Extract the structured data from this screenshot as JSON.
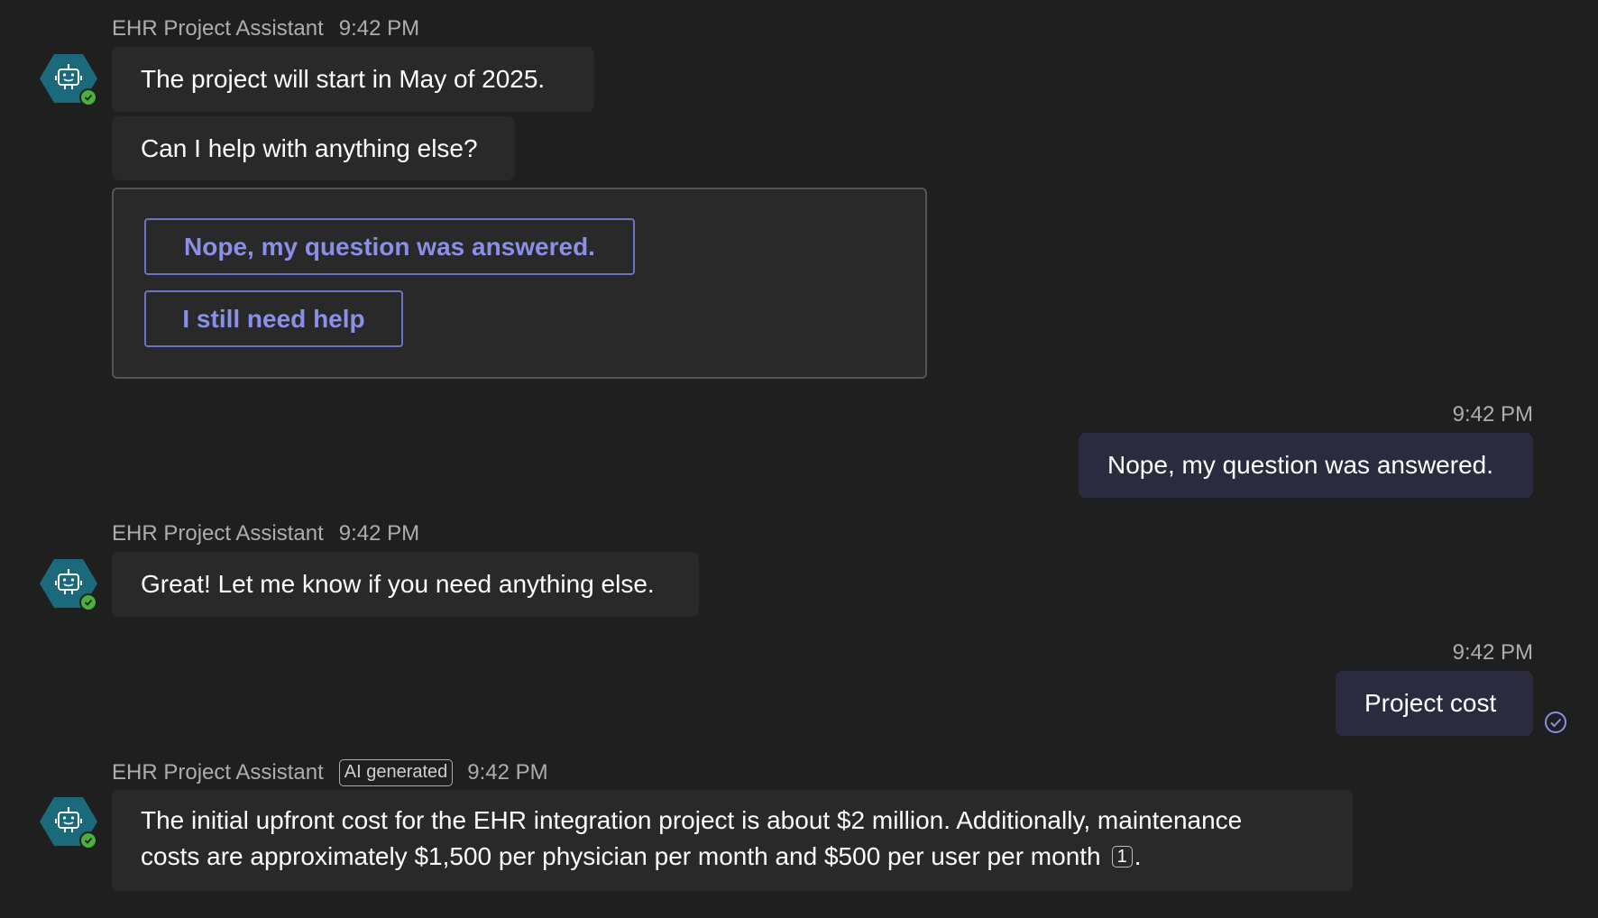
{
  "messages": [
    {
      "sender": "EHR Project Assistant",
      "time": "9:42 PM",
      "texts": [
        "The project will start in May of 2025.",
        "Can I help with anything else?"
      ],
      "actions": [
        "Nope, my question was answered.",
        "I still need help"
      ]
    },
    {
      "time": "9:42 PM",
      "text": "Nope, my question was answered."
    },
    {
      "sender": "EHR Project Assistant",
      "time": "9:42 PM",
      "text": "Great! Let me know if you need anything else."
    },
    {
      "time": "9:42 PM",
      "text": "Project cost"
    },
    {
      "sender": "EHR Project Assistant",
      "badge": "AI generated",
      "time": "9:42 PM",
      "text_line1": "The initial upfront cost for the EHR integration project is about $2 million. Additionally, maintenance",
      "text_line2": "costs are approximately $1,500 per physician per month and $500 per user per month",
      "citation": "1",
      "text_end": "."
    }
  ],
  "colors": {
    "background": "#1f1f1f",
    "bot_bubble": "#292929",
    "user_bubble": "#2b2b40",
    "accent": "#8a8fe8",
    "avatar": "#1a6a7c",
    "status_online": "#4caf3c"
  },
  "icons": {
    "avatar": "bot-icon",
    "status": "check-badge-icon",
    "receipt": "read-receipt-icon"
  }
}
